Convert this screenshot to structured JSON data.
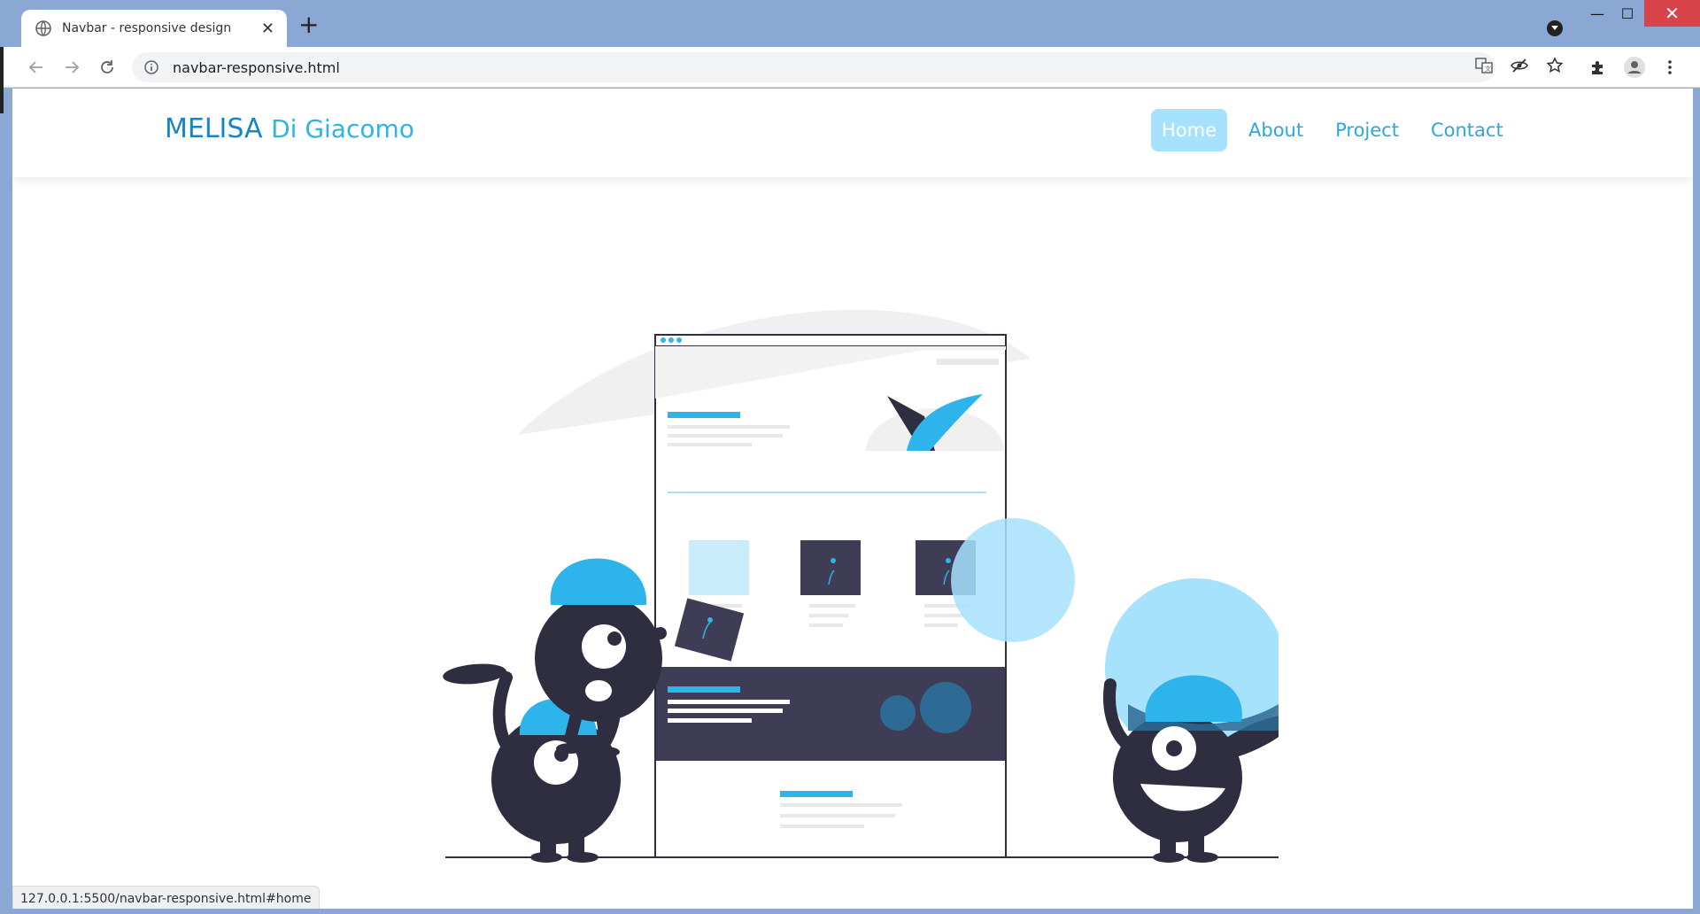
{
  "browser": {
    "tab_title": "Navbar - responsive design",
    "tab_close": "✕",
    "new_tab": "+",
    "url": "navbar-responsive.html",
    "status_url": "127.0.0.1:5500/navbar-responsive.html#home",
    "window_controls": {
      "minimize": "—",
      "maximize": "☐",
      "close": "✕"
    }
  },
  "site": {
    "logo_first": "MELISA",
    "logo_last": "Di Giacomo",
    "nav": [
      {
        "label": "Home",
        "active": true
      },
      {
        "label": "About",
        "active": false
      },
      {
        "label": "Project",
        "active": false
      },
      {
        "label": "Contact",
        "active": false
      }
    ]
  },
  "colors": {
    "accent": "#2db4eb",
    "accent_light": "#a6e2fb",
    "dark": "#2f2e41",
    "titlebar": "#8aa8d3"
  },
  "icons": [
    "globe-icon",
    "back-arrow-icon",
    "forward-arrow-icon",
    "reload-icon",
    "info-icon",
    "translate-icon",
    "eye-off-icon",
    "star-icon",
    "extensions-icon",
    "account-icon",
    "menu-dots-icon"
  ]
}
